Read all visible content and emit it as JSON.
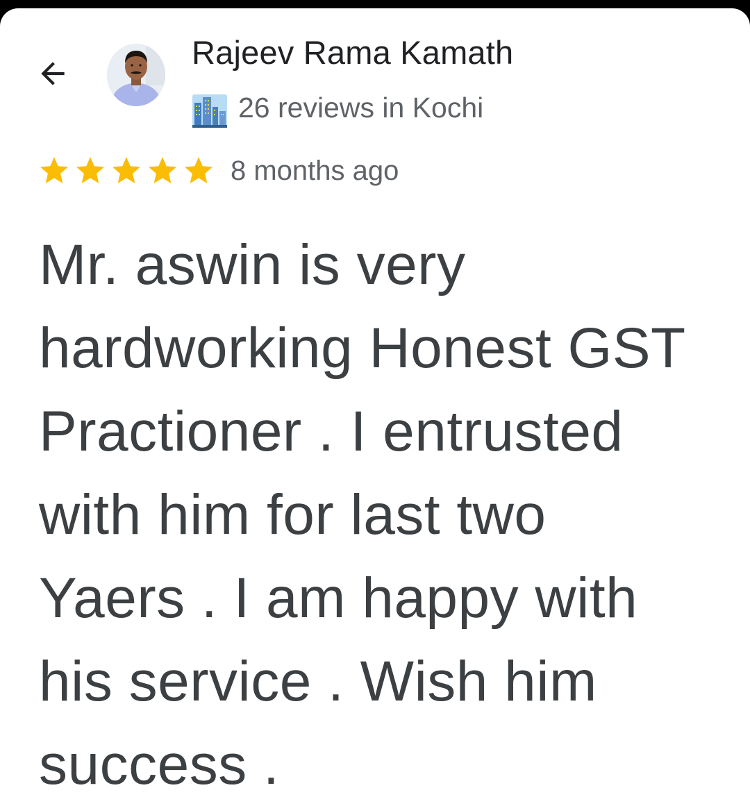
{
  "reviewer": {
    "name": "Rajeev Rama Kamath",
    "review_count_text": "26 reviews in Kochi",
    "avatar_icon": "person-avatar",
    "badge_icon": "city-buildings-icon"
  },
  "review": {
    "rating": 5,
    "max_rating": 5,
    "time": "8 months ago",
    "text": "Mr. aswin is very hardworking Honest GST Practioner . I entrusted with him for last two Yaers . I am happy with his service . Wish him success ."
  },
  "navigation": {
    "back_icon": "back-arrow-icon"
  },
  "colors": {
    "star": "#fbbc04",
    "name_text": "#202124",
    "secondary_text": "#5f6368",
    "body_text": "#3c4043",
    "background": "#ffffff"
  }
}
